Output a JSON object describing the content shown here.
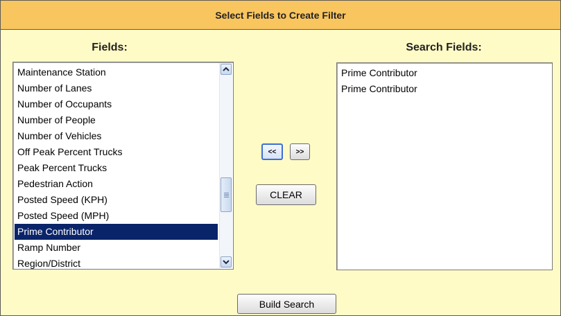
{
  "header": {
    "title": "Select Fields to Create Filter"
  },
  "fields": {
    "title": "Fields:",
    "items": [
      "Maintenance Station",
      "Number of Lanes",
      "Number of Occupants",
      "Number of People",
      "Number of Vehicles",
      "Off Peak Percent Trucks",
      "Peak Percent Trucks",
      "Pedestrian Action",
      "Posted Speed (KPH)",
      "Posted Speed (MPH)",
      "Prime Contributor",
      "Ramp Number",
      "Region/District"
    ],
    "selected": "Prime Contributor"
  },
  "search_fields": {
    "title": "Search Fields:",
    "items": [
      "Prime Contributor",
      "Prime Contributor"
    ]
  },
  "buttons": {
    "move_left": "<<",
    "move_right": ">>",
    "clear": "CLEAR",
    "build_search": "Build Search"
  },
  "icons": {
    "scroll_up": "chevron-up-icon",
    "scroll_down": "chevron-down-icon",
    "thumb": "grip-icon"
  },
  "colors": {
    "header_bg": "#f9c55f",
    "panel_bg": "#fffbc7",
    "selection": "#0a246a"
  }
}
